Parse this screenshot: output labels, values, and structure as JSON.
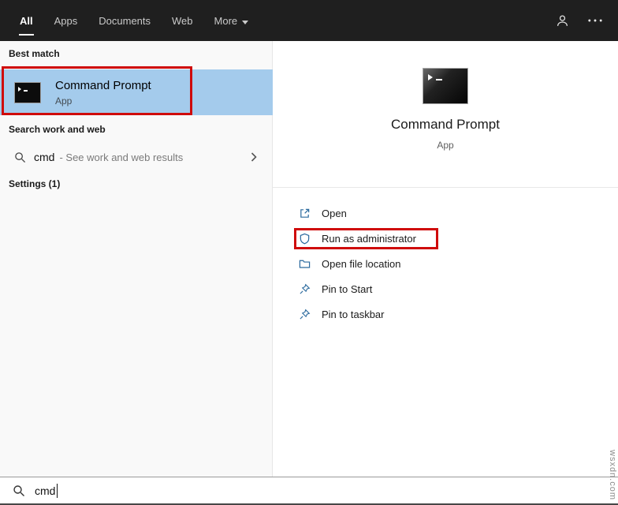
{
  "topbar": {
    "tabs": [
      {
        "label": "All",
        "selected": true
      },
      {
        "label": "Apps",
        "selected": false
      },
      {
        "label": "Documents",
        "selected": false
      },
      {
        "label": "Web",
        "selected": false
      },
      {
        "label": "More",
        "selected": false,
        "dropdown": true
      }
    ],
    "icons": [
      "user-icon",
      "ellipsis-icon"
    ]
  },
  "left_panel": {
    "best_match_header": "Best match",
    "best_match": {
      "title": "Command Prompt",
      "subtitle": "App",
      "icon": "command-prompt-icon"
    },
    "web_section_header": "Search work and web",
    "web_suggestion": {
      "query": "cmd",
      "hint": "- See work and web results",
      "icon": "search-icon",
      "chevron": "chevron-right-icon"
    },
    "settings_header": "Settings (1)"
  },
  "right_panel": {
    "app_title": "Command Prompt",
    "app_subtitle": "App",
    "app_icon": "command-prompt-icon",
    "actions": [
      {
        "label": "Open",
        "icon": "open-icon",
        "annotated": false
      },
      {
        "label": "Run as administrator",
        "icon": "shield-icon",
        "annotated": true
      },
      {
        "label": "Open file location",
        "icon": "folder-icon",
        "annotated": false
      },
      {
        "label": "Pin to Start",
        "icon": "pin-icon",
        "annotated": false
      },
      {
        "label": "Pin to taskbar",
        "icon": "pin-icon",
        "annotated": false
      }
    ]
  },
  "search_bar": {
    "value": "cmd",
    "icon": "search-icon"
  },
  "watermark": "wsxdn.com",
  "colors": {
    "topbar_bg": "#1f1f1f",
    "highlight_blue": "#a4cbec",
    "annotation_red": "#cf0b0b",
    "action_icon_blue": "#2b6a9e"
  }
}
